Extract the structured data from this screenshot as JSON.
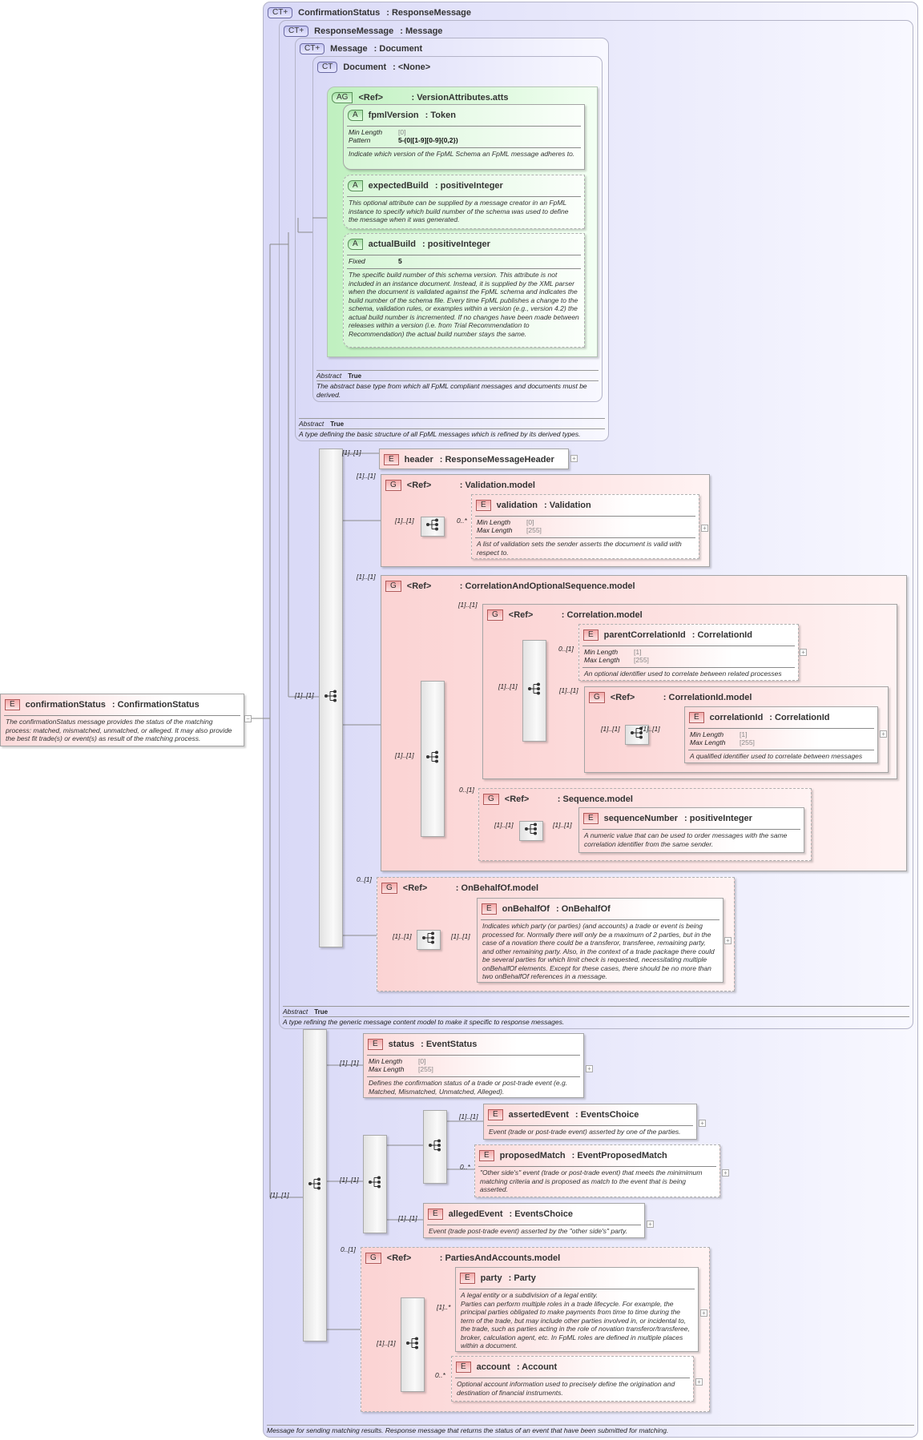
{
  "root": {
    "badge": "E",
    "name": "confirmationStatus",
    "type": "ConfirmationStatus",
    "desc": "The confirmationStatus message provides the status of the matching process: matched, mismatched, unmatched, or alleged. It may also provide the best fit trade(s) or event(s) as result of the matching process."
  },
  "ct_confirmation": {
    "badge": "CT+",
    "name": "ConfirmationStatus",
    "type": "ResponseMessage",
    "desc": "Message for sending matching results. Response message that returns the status of an event that have been submitted for matching."
  },
  "ct_response": {
    "badge": "CT+",
    "name": "ResponseMessage",
    "type": "Message",
    "abstract_label": "Abstract",
    "abstract_value": "True",
    "desc": "A type refining the generic message content model to make it specific to response messages."
  },
  "ct_message": {
    "badge": "CT+",
    "name": "Message",
    "type": "Document",
    "abstract_label": "Abstract",
    "abstract_value": "True",
    "desc": "A type defining the basic structure of all FpML messages which is refined by its derived types."
  },
  "ct_document": {
    "badge": "CT",
    "name": "Document",
    "type": "<None>",
    "abstract_label": "Abstract",
    "abstract_value": "True",
    "desc": "The abstract base type from which all FpML compliant messages and documents must be derived."
  },
  "ag_version": {
    "badge": "AG",
    "name": "<Ref>",
    "type": "VersionAttributes.atts"
  },
  "attr_fpml": {
    "badge": "A",
    "name": "fpmlVersion",
    "type": "Token",
    "props": [
      [
        "Min Length",
        "[0]"
      ],
      [
        "Pattern",
        "5-(0|[1-9][0-9]{0,2})"
      ]
    ],
    "desc": "Indicate which version of the FpML Schema an FpML message adheres to."
  },
  "attr_expected": {
    "badge": "A",
    "name": "expectedBuild",
    "type": "positiveInteger",
    "desc": "This optional attribute can be supplied by a message creator in an FpML instance to specify which build number of the schema was used to define the message when it was generated."
  },
  "attr_actual": {
    "badge": "A",
    "name": "actualBuild",
    "type": "positiveInteger",
    "props": [
      [
        "Fixed",
        "5"
      ]
    ],
    "desc": "The specific build number of this schema version. This attribute is not included in an instance document. Instead, it is supplied by the XML parser when the document is validated against the FpML schema and indicates the build number of the schema file. Every time FpML publishes a change to the schema, validation rules, or examples within a version (e.g., version 4.2) the actual build number is incremented. If no changes have been made between releases within a version (i.e. from Trial Recommendation to Recommendation) the actual build number stays the same."
  },
  "el_header": {
    "badge": "E",
    "name": "header",
    "type": "ResponseMessageHeader"
  },
  "g_validation": {
    "badge": "G",
    "name": "<Ref>",
    "type": "Validation.model"
  },
  "el_validation": {
    "badge": "E",
    "name": "validation",
    "type": "Validation",
    "props": [
      [
        "Min Length",
        "[0]"
      ],
      [
        "Max Length",
        "[255]"
      ]
    ],
    "desc": "A list of validation sets the sender asserts the document is valid with respect to."
  },
  "g_corr_opt_seq": {
    "badge": "G",
    "name": "<Ref>",
    "type": "CorrelationAndOptionalSequence.model"
  },
  "g_correlation": {
    "badge": "G",
    "name": "<Ref>",
    "type": "Correlation.model"
  },
  "el_parent_corr": {
    "badge": "E",
    "name": "parentCorrelationId",
    "type": "CorrelationId",
    "props": [
      [
        "Min Length",
        "[1]"
      ],
      [
        "Max Length",
        "[255]"
      ]
    ],
    "desc": "An optional identifier used to correlate between related processes"
  },
  "g_corr_id": {
    "badge": "G",
    "name": "<Ref>",
    "type": "CorrelationId.model"
  },
  "el_corr_id": {
    "badge": "E",
    "name": "correlationId",
    "type": "CorrelationId",
    "props": [
      [
        "Min Length",
        "[1]"
      ],
      [
        "Max Length",
        "[255]"
      ]
    ],
    "desc": "A qualified identifier used to correlate between messages"
  },
  "g_sequence": {
    "badge": "G",
    "name": "<Ref>",
    "type": "Sequence.model"
  },
  "el_seq_number": {
    "badge": "E",
    "name": "sequenceNumber",
    "type": "positiveInteger",
    "desc": "A numeric value that can be used to order messages with the same correlation identifier from the same sender."
  },
  "g_on_behalf": {
    "badge": "G",
    "name": "<Ref>",
    "type": "OnBehalfOf.model"
  },
  "el_on_behalf": {
    "badge": "E",
    "name": "onBehalfOf",
    "type": "OnBehalfOf",
    "desc": "Indicates which party (or parties) (and accounts) a trade or event is being processed for. Normally there will only be a maximum of 2 parties, but in the case of a novation there could be a transferor, transferee, remaining party, and other remaining party. Also, in the context of a trade package there could be several parties for which limit check is requested, necessitating multiple onBehalfOf elements. Except for these cases, there should be no more than two onBehalfOf references in a message."
  },
  "el_status": {
    "badge": "E",
    "name": "status",
    "type": "EventStatus",
    "props": [
      [
        "Min Length",
        "[0]"
      ],
      [
        "Max Length",
        "[255]"
      ]
    ],
    "desc": "Defines the confirmation status of a trade or post-trade event (e.g. Matched, Mismatched, Unmatched, Alleged)."
  },
  "el_asserted": {
    "badge": "E",
    "name": "assertedEvent",
    "type": "EventsChoice",
    "desc": "Event (trade or post-trade event) asserted by one of the parties."
  },
  "el_proposed": {
    "badge": "E",
    "name": "proposedMatch",
    "type": "EventProposedMatch",
    "desc": "\"Other side's\" event (trade or post-trade event) that meets the minimimum matching criteria and is proposed as match to the event that is being asserted."
  },
  "el_alleged": {
    "badge": "E",
    "name": "allegedEvent",
    "type": "EventsChoice",
    "desc": "Event (trade post-trade event) asserted by the \"other side's\" party."
  },
  "g_parties": {
    "badge": "G",
    "name": "<Ref>",
    "type": "PartiesAndAccounts.model"
  },
  "el_party": {
    "badge": "E",
    "name": "party",
    "type": "Party",
    "desc": "A legal entity or a subdivision of a legal entity.\nParties can perform multiple roles in a trade lifecycle. For example, the principal parties obligated to make payments from time to time during the term of the trade, but may include other parties involved in, or incidental to, the trade, such as parties acting in the role of novation transferor/transferee, broker, calculation agent, etc. In FpML roles are defined in multiple places within a document."
  },
  "el_account": {
    "badge": "E",
    "name": "account",
    "type": "Account",
    "desc": "Optional account information used to precisely define the origination and destination of financial instruments."
  },
  "cardinalities": [
    "[1]..[1]",
    "[1]..[1]",
    "[1]..[1]",
    "[1]..[1]",
    "0..*",
    "[1]..[1]",
    "[1]..[1]",
    "[1]..[1]",
    "[1]..[1]",
    "0..[1]",
    "[1]..[1]",
    "[1]..[1]",
    "[1]..[1]",
    "0..[1]",
    "[1]..[1]",
    "[1]..[1]",
    "0..[1]",
    "[1]..[1]",
    "[1]..[1]",
    "[1]..[1]",
    "[1]..[1]",
    "[1]..[1]",
    "[1]..[1]",
    "0..*",
    "[1]..[1]",
    "0..[1]",
    "[1]..[1]",
    "[1]..*",
    "0..*"
  ],
  "expand_symbol": "+",
  "collapse_symbol": "−"
}
